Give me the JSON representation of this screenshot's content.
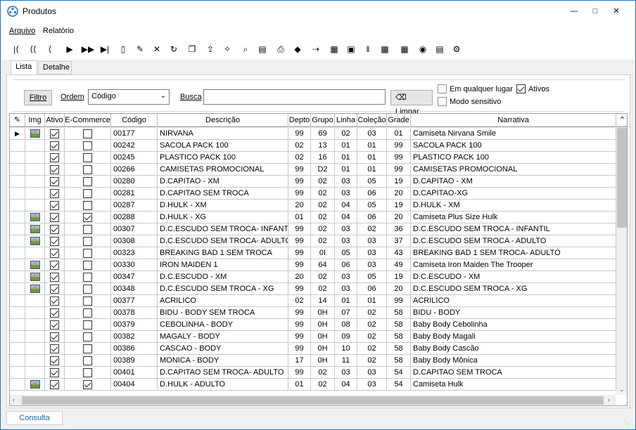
{
  "window": {
    "title": "Produtos"
  },
  "menu": [
    "Arquivo",
    "Relatório"
  ],
  "toolbar_icons": [
    "first-icon",
    "prior-page-icon",
    "prior-icon",
    "next-icon",
    "next-page-icon",
    "last-icon",
    "new-icon",
    "edit-icon",
    "delete-icon",
    "refresh-icon",
    "copy-icon",
    "export-icon",
    "magic-icon",
    "preview-icon",
    "document-icon",
    "print-icon",
    "tag-icon",
    "goto-icon",
    "filter-icon",
    "image-export-icon",
    "barcode-icon",
    "excel-icon",
    "calculator-icon",
    "color-icon",
    "notepad-icon",
    "config-icon"
  ],
  "tabs": [
    "Lista",
    "Detalhe"
  ],
  "filter": {
    "filtro_label": "Filtro",
    "ordem_label": "Ordem",
    "ordem_value": "Código",
    "busca_label": "Busca",
    "busca_value": "",
    "limpar_label": "Limpar",
    "em_qualquer_lugar": "Em qualquer lugar",
    "ativos": "Ativos",
    "modo_sensitivo": "Modo sensitivo",
    "em_qualquer_lugar_checked": false,
    "ativos_checked": true,
    "modo_sensitivo_checked": false
  },
  "grid": {
    "columns": [
      "Img",
      "Ativo",
      "E-Commerce",
      "Código",
      "Descrição",
      "Depto",
      "Grupo",
      "Linha",
      "Coleção",
      "Grade",
      "Narrativa"
    ],
    "rows": [
      {
        "img": true,
        "ativo": true,
        "ecom": false,
        "codigo": "00177",
        "descricao": "NIRVANA",
        "depto": "99",
        "grupo": "69",
        "linha": "02",
        "colecao": "03",
        "grade": "01",
        "narrativa": "Camiseta Nirvana Smile"
      },
      {
        "img": false,
        "ativo": true,
        "ecom": false,
        "codigo": "00242",
        "descricao": "SACOLA PACK 100",
        "depto": "02",
        "grupo": "13",
        "linha": "01",
        "colecao": "01",
        "grade": "99",
        "narrativa": "SACOLA PACK 100"
      },
      {
        "img": false,
        "ativo": true,
        "ecom": false,
        "codigo": "00245",
        "descricao": "PLASTICO PACK 100",
        "depto": "02",
        "grupo": "16",
        "linha": "01",
        "colecao": "01",
        "grade": "99",
        "narrativa": "PLASTICO PACK 100"
      },
      {
        "img": false,
        "ativo": true,
        "ecom": false,
        "codigo": "00266",
        "descricao": "CAMISETAS PROMOCIONAL",
        "depto": "99",
        "grupo": "D2",
        "linha": "01",
        "colecao": "01",
        "grade": "99",
        "narrativa": "CAMISETAS PROMOCIONAL"
      },
      {
        "img": false,
        "ativo": true,
        "ecom": false,
        "codigo": "00280",
        "descricao": "D.CAPITAO - XM",
        "depto": "99",
        "grupo": "02",
        "linha": "03",
        "colecao": "05",
        "grade": "19",
        "narrativa": "D.CAPITAO - XM"
      },
      {
        "img": false,
        "ativo": true,
        "ecom": false,
        "codigo": "00281",
        "descricao": "D.CAPITAO SEM TROCA",
        "depto": "99",
        "grupo": "02",
        "linha": "03",
        "colecao": "06",
        "grade": "20",
        "narrativa": "D.CAPITAO-XG"
      },
      {
        "img": false,
        "ativo": true,
        "ecom": false,
        "codigo": "00287",
        "descricao": "D.HULK - XM",
        "depto": "20",
        "grupo": "02",
        "linha": "04",
        "colecao": "05",
        "grade": "19",
        "narrativa": "D.HULK - XM"
      },
      {
        "img": true,
        "ativo": true,
        "ecom": true,
        "codigo": "00288",
        "descricao": "D.HULK - XG",
        "depto": "01",
        "grupo": "02",
        "linha": "04",
        "colecao": "06",
        "grade": "20",
        "narrativa": "Camiseta Plus Size Hulk"
      },
      {
        "img": true,
        "ativo": true,
        "ecom": false,
        "codigo": "00307",
        "descricao": "D.C.ESCUDO SEM TROCA- INFANTI",
        "depto": "99",
        "grupo": "02",
        "linha": "03",
        "colecao": "02",
        "grade": "36",
        "narrativa": "D.C.ESCUDO SEM TROCA - INFANTIL"
      },
      {
        "img": true,
        "ativo": true,
        "ecom": false,
        "codigo": "00308",
        "descricao": "D.C.ESCUDO SEM TROCA- ADULTO",
        "depto": "99",
        "grupo": "02",
        "linha": "03",
        "colecao": "03",
        "grade": "37",
        "narrativa": "D.C.ESCUDO SEM TROCA - ADULTO"
      },
      {
        "img": false,
        "ativo": true,
        "ecom": false,
        "codigo": "00323",
        "descricao": "BREAKING BAD 1 SEM TROCA",
        "depto": "99",
        "grupo": "0I",
        "linha": "05",
        "colecao": "03",
        "grade": "43",
        "narrativa": "BREAKING BAD 1 SEM TROCA- ADULTO"
      },
      {
        "img": true,
        "ativo": true,
        "ecom": false,
        "codigo": "00330",
        "descricao": "IRON MAIDEN 1",
        "depto": "99",
        "grupo": "64",
        "linha": "06",
        "colecao": "03",
        "grade": "49",
        "narrativa": "Camiseta Iron Maiden The Trooper"
      },
      {
        "img": true,
        "ativo": true,
        "ecom": false,
        "codigo": "00347",
        "descricao": "D.C.ESCUDO - XM",
        "depto": "20",
        "grupo": "02",
        "linha": "03",
        "colecao": "05",
        "grade": "19",
        "narrativa": "D.C.ESCUDO - XM"
      },
      {
        "img": true,
        "ativo": true,
        "ecom": false,
        "codigo": "00348",
        "descricao": "D.C.ESCUDO SEM TROCA - XG",
        "depto": "99",
        "grupo": "02",
        "linha": "03",
        "colecao": "06",
        "grade": "20",
        "narrativa": "D.C.ESCUDO SEM TROCA - XG"
      },
      {
        "img": false,
        "ativo": true,
        "ecom": false,
        "codigo": "00377",
        "descricao": "ACRILICO",
        "depto": "02",
        "grupo": "14",
        "linha": "01",
        "colecao": "01",
        "grade": "99",
        "narrativa": "ACRILICO"
      },
      {
        "img": false,
        "ativo": true,
        "ecom": false,
        "codigo": "00378",
        "descricao": "BIDU - BODY SEM TROCA",
        "depto": "99",
        "grupo": "0H",
        "linha": "07",
        "colecao": "02",
        "grade": "58",
        "narrativa": "BIDU - BODY"
      },
      {
        "img": false,
        "ativo": true,
        "ecom": false,
        "codigo": "00379",
        "descricao": "CEBOLINHA - BODY",
        "depto": "99",
        "grupo": "0H",
        "linha": "08",
        "colecao": "02",
        "grade": "58",
        "narrativa": "Baby Body Cebolinha"
      },
      {
        "img": false,
        "ativo": true,
        "ecom": false,
        "codigo": "00382",
        "descricao": "MAGALY - BODY",
        "depto": "99",
        "grupo": "0H",
        "linha": "09",
        "colecao": "02",
        "grade": "58",
        "narrativa": "Baby Body Magali"
      },
      {
        "img": false,
        "ativo": true,
        "ecom": false,
        "codigo": "00386",
        "descricao": "CASCAO - BODY",
        "depto": "99",
        "grupo": "0H",
        "linha": "10",
        "colecao": "02",
        "grade": "58",
        "narrativa": "Baby Body Cascão"
      },
      {
        "img": false,
        "ativo": true,
        "ecom": false,
        "codigo": "00389",
        "descricao": "MONICA - BODY",
        "depto": "17",
        "grupo": "0H",
        "linha": "11",
        "colecao": "02",
        "grade": "58",
        "narrativa": "Baby Body Mônica"
      },
      {
        "img": false,
        "ativo": true,
        "ecom": false,
        "codigo": "00401",
        "descricao": "D.CAPITAO SEM TROCA- ADULTO",
        "depto": "99",
        "grupo": "02",
        "linha": "03",
        "colecao": "03",
        "grade": "54",
        "narrativa": "D.CAPITAO SEM TROCA"
      },
      {
        "img": true,
        "ativo": true,
        "ecom": true,
        "codigo": "00404",
        "descricao": "D.HULK - ADULTO",
        "depto": "01",
        "grupo": "02",
        "linha": "04",
        "colecao": "03",
        "grade": "54",
        "narrativa": "Camiseta Hulk"
      }
    ]
  },
  "status": {
    "tab": "Consulta"
  }
}
